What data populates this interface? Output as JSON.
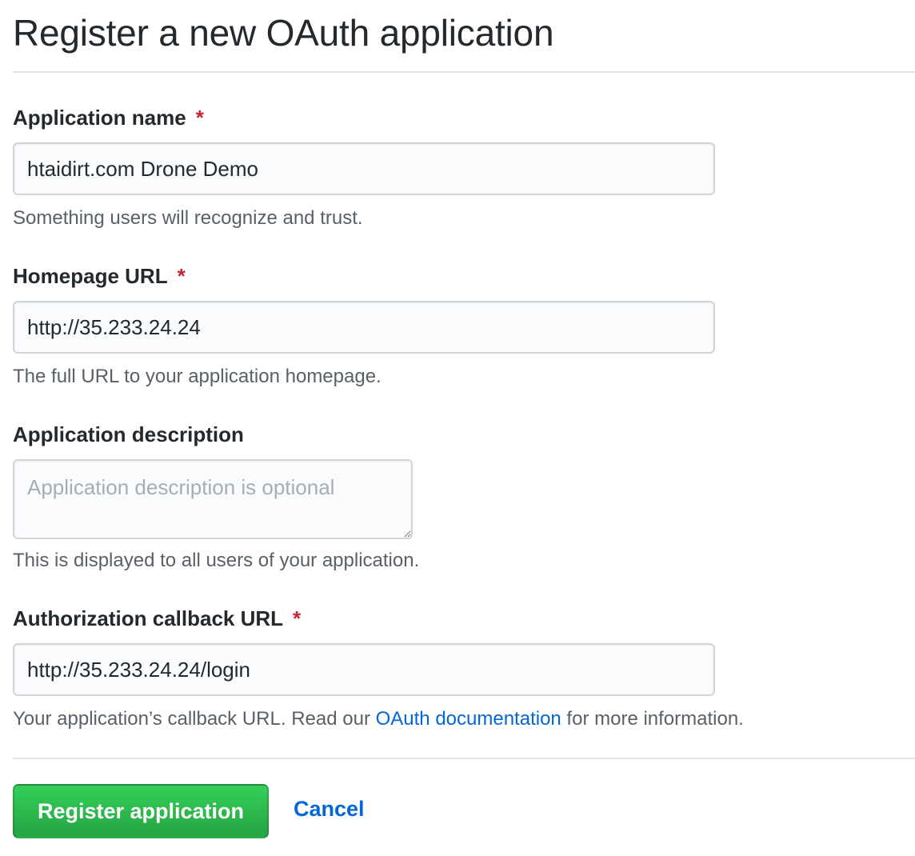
{
  "page": {
    "title": "Register a new OAuth application"
  },
  "form": {
    "app_name": {
      "label": "Application name",
      "required_mark": "*",
      "value": "htaidirt.com Drone Demo",
      "note": "Something users will recognize and trust."
    },
    "homepage_url": {
      "label": "Homepage URL",
      "required_mark": "*",
      "value": "http://35.233.24.24",
      "note": "The full URL to your application homepage."
    },
    "description": {
      "label": "Application description",
      "value": "",
      "placeholder": "Application description is optional",
      "note": "This is displayed to all users of your application."
    },
    "callback_url": {
      "label": "Authorization callback URL",
      "required_mark": "*",
      "value": "http://35.233.24.24/login",
      "note_before": "Your application’s callback URL. Read our ",
      "note_link": "OAuth documentation",
      "note_after": " for more information."
    }
  },
  "actions": {
    "register_label": "Register application",
    "cancel_label": "Cancel"
  },
  "colors": {
    "primary_green": "#28a745",
    "link_blue": "#0366d6",
    "required_red": "#cb2431"
  }
}
